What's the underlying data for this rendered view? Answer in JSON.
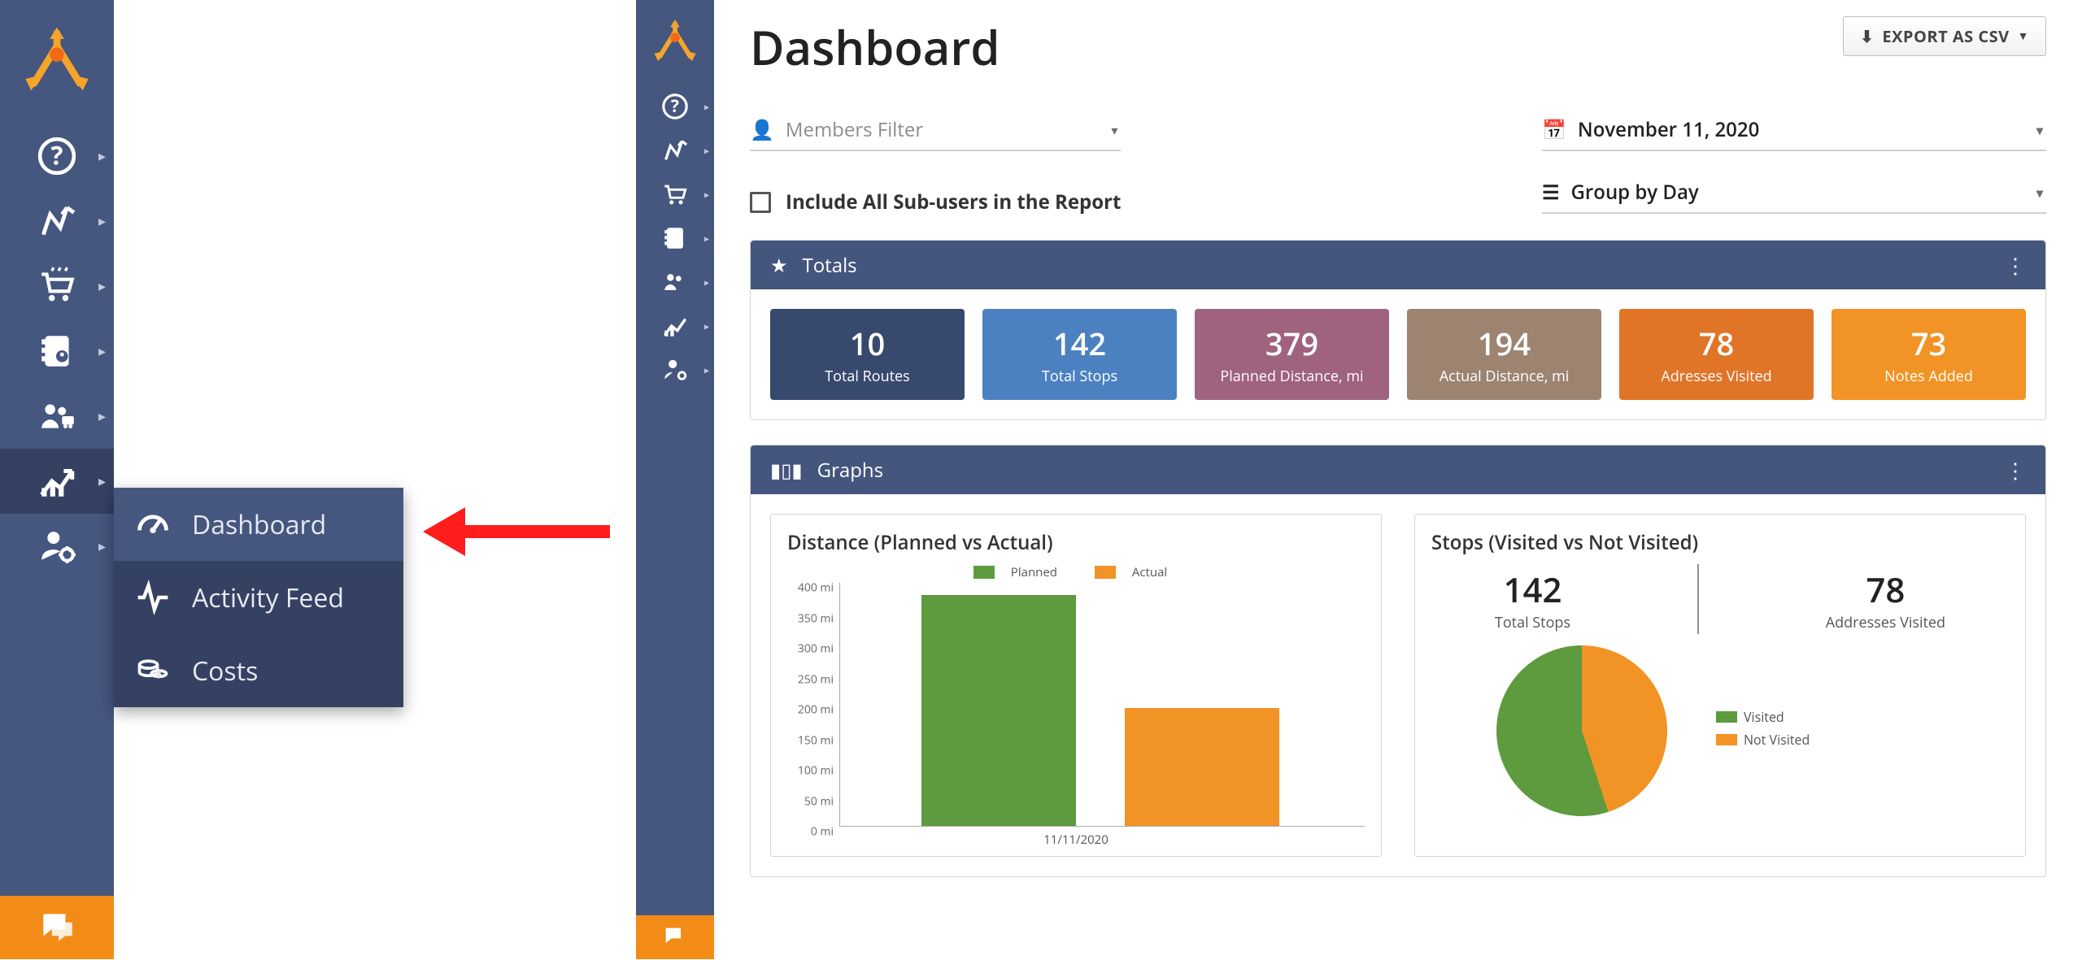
{
  "page_title": "Dashboard",
  "export_button": "EXPORT AS CSV",
  "members_filter_placeholder": "Members Filter",
  "date_filter_value": "November 11, 2020",
  "group_filter_value": "Group by Day",
  "include_sub_users_label": "Include All Sub-users in the Report",
  "sidebar1_flyout": {
    "dashboard": "Dashboard",
    "activity": "Activity Feed",
    "costs": "Costs"
  },
  "totals_panel_title": "Totals",
  "totals": [
    {
      "value": "10",
      "label": "Total Routes",
      "color": "c-navy"
    },
    {
      "value": "142",
      "label": "Total Stops",
      "color": "c-blue"
    },
    {
      "value": "379",
      "label": "Planned Distance, mi",
      "color": "c-plum"
    },
    {
      "value": "194",
      "label": "Actual Distance, mi",
      "color": "c-taupe"
    },
    {
      "value": "78",
      "label": "Adresses Visited",
      "color": "c-orangeD"
    },
    {
      "value": "73",
      "label": "Notes Added",
      "color": "c-orangeL"
    }
  ],
  "graphs_panel_title": "Graphs",
  "graph_distance_title": "Distance (Planned vs Actual)",
  "graph_stops_title": "Stops (Visited vs Not Visited)",
  "stops_stats": {
    "total_stops_val": "142",
    "total_stops_lbl": "Total Stops",
    "visited_val": "78",
    "visited_lbl": "Addresses Visited"
  },
  "legend": {
    "planned": "Planned",
    "actual": "Actual",
    "visited": "Visited",
    "not_visited": "Not Visited"
  },
  "chart_data": [
    {
      "type": "bar",
      "title": "Distance (Planned vs Actual)",
      "categories": [
        "11/11/2020"
      ],
      "series": [
        {
          "name": "Planned",
          "values": [
            379
          ]
        },
        {
          "name": "Actual",
          "values": [
            194
          ]
        }
      ],
      "ylabel": "mi",
      "ylim": [
        0,
        400
      ],
      "yticks": [
        0,
        50,
        100,
        150,
        200,
        250,
        300,
        350,
        400
      ],
      "x_label_text": "11/11/2020"
    },
    {
      "type": "pie",
      "title": "Stops (Visited vs Not Visited)",
      "series": [
        {
          "name": "Visited",
          "value": 78
        },
        {
          "name": "Not Visited",
          "value": 64
        }
      ],
      "total": 142
    }
  ]
}
